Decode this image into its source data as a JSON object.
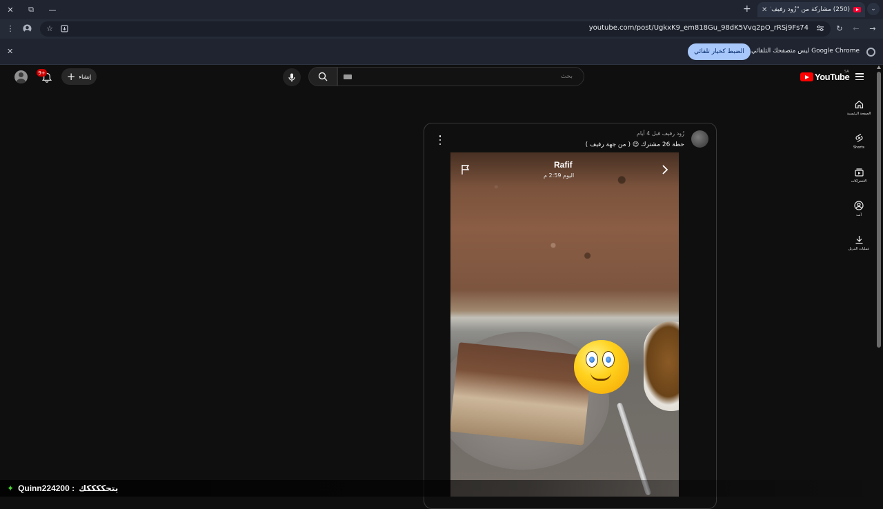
{
  "browser": {
    "tab_title": "(250) مشاركة من \"زُود رفيف\" - ⁠",
    "url": "youtube.com/post/UgkxK9_em818Gu_98dK5Vvq2pO_rRSj9Fs74",
    "infobar_text": "Google Chrome ليس متصفحك التلقائي.",
    "infobar_button": "الضبط كخيار تلقائي"
  },
  "youtube": {
    "logo_text": "YouTube",
    "region": "SA",
    "search_placeholder": "بحث",
    "create_label": "إنشاء",
    "notification_count": "9+",
    "guide": [
      {
        "label": "الصفحة الرئيسية",
        "icon": "home-icon"
      },
      {
        "label": "Shorts",
        "icon": "shorts-icon"
      },
      {
        "label": "الاشتراكات",
        "icon": "subscriptions-icon"
      },
      {
        "label": "أنت",
        "icon": "you-icon"
      },
      {
        "label": "عمليات التنزيل",
        "icon": "download-icon"
      }
    ]
  },
  "post": {
    "author_line": "زُود رفيف  قبل 4 أيام",
    "text": "حطة 26 مشترك 😍 ( من جهة رفيف )",
    "story_name": "Rafif",
    "story_time": "اليوم 2:59 م"
  },
  "chat": {
    "user": "Quinn224200 :",
    "message": "يتحككككك"
  },
  "colors": {
    "accent_button": "#a8c7fa",
    "youtube_red": "#ff0000",
    "badge_red": "#cc0000"
  }
}
